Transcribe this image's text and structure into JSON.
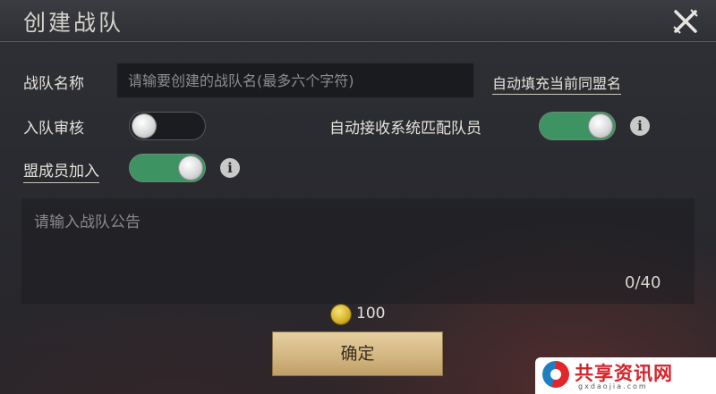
{
  "header": {
    "title": "创建战队"
  },
  "form": {
    "team_name_label": "战队名称",
    "team_name_placeholder": "请输要创建的战队名(最多六个字符)",
    "autofill_link": "自动填充当前同盟名",
    "review_label": "入队审核",
    "review_enabled": false,
    "auto_accept_label": "自动接收系统匹配队员",
    "auto_accept_enabled": true,
    "alliance_join_label": "盟成员加入",
    "alliance_join_enabled": true,
    "info_symbol": "i",
    "notice_placeholder": "请输入战队公告",
    "notice_counter": "0/40"
  },
  "footer": {
    "cost": "100",
    "confirm_label": "确定"
  },
  "watermark": {
    "text": "共享资讯网",
    "subtext": "gxdaojia.com"
  },
  "colors": {
    "toggle_on": "#3e9363",
    "confirm_bg": "#d3b682",
    "coin": "#d8b52c",
    "watermark_red": "#d7232b"
  },
  "icons": {
    "close": "crossed-swords-close-icon",
    "info": "info-icon",
    "coin": "gold-coin-icon"
  }
}
